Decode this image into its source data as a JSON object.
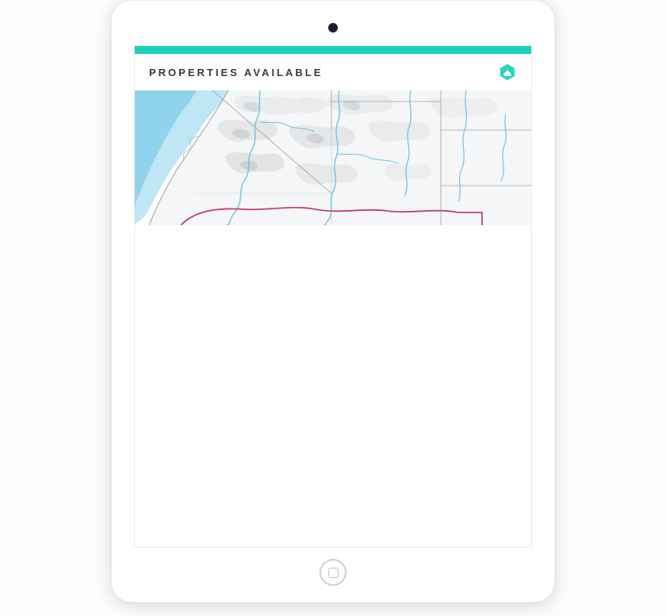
{
  "header": {
    "title": "PROPERTIES AVAILABLE"
  },
  "colors": {
    "accent": "#1dd1b8",
    "ocean_light": "#bfe6f5",
    "ocean_deep": "#8fd3ed",
    "terrain_light": "#f1f2f3",
    "terrain_mid": "#e1e3e5",
    "terrain_dark": "#d0d3d6",
    "river": "#6ec3e8",
    "border_state": "#9aa0a6",
    "border_country": "#c0407f"
  },
  "icons": {
    "logo": "hexagon-house"
  }
}
